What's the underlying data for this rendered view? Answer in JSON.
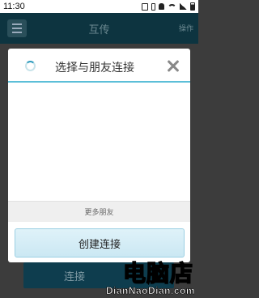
{
  "status_bar": {
    "time": "11:30"
  },
  "app_header": {
    "title": "互传",
    "action_label": "操作"
  },
  "dialog": {
    "title": "选择与朋友连接",
    "more_friends_label": "更多朋友",
    "create_button_label": "创建连接"
  },
  "background": {
    "connect_button_label": "连接"
  },
  "watermark": {
    "text_cn": "电脑店",
    "text_en": "DianNaoDian.com"
  },
  "colors": {
    "accent": "#5cbfd8",
    "header": "#0d3440"
  }
}
